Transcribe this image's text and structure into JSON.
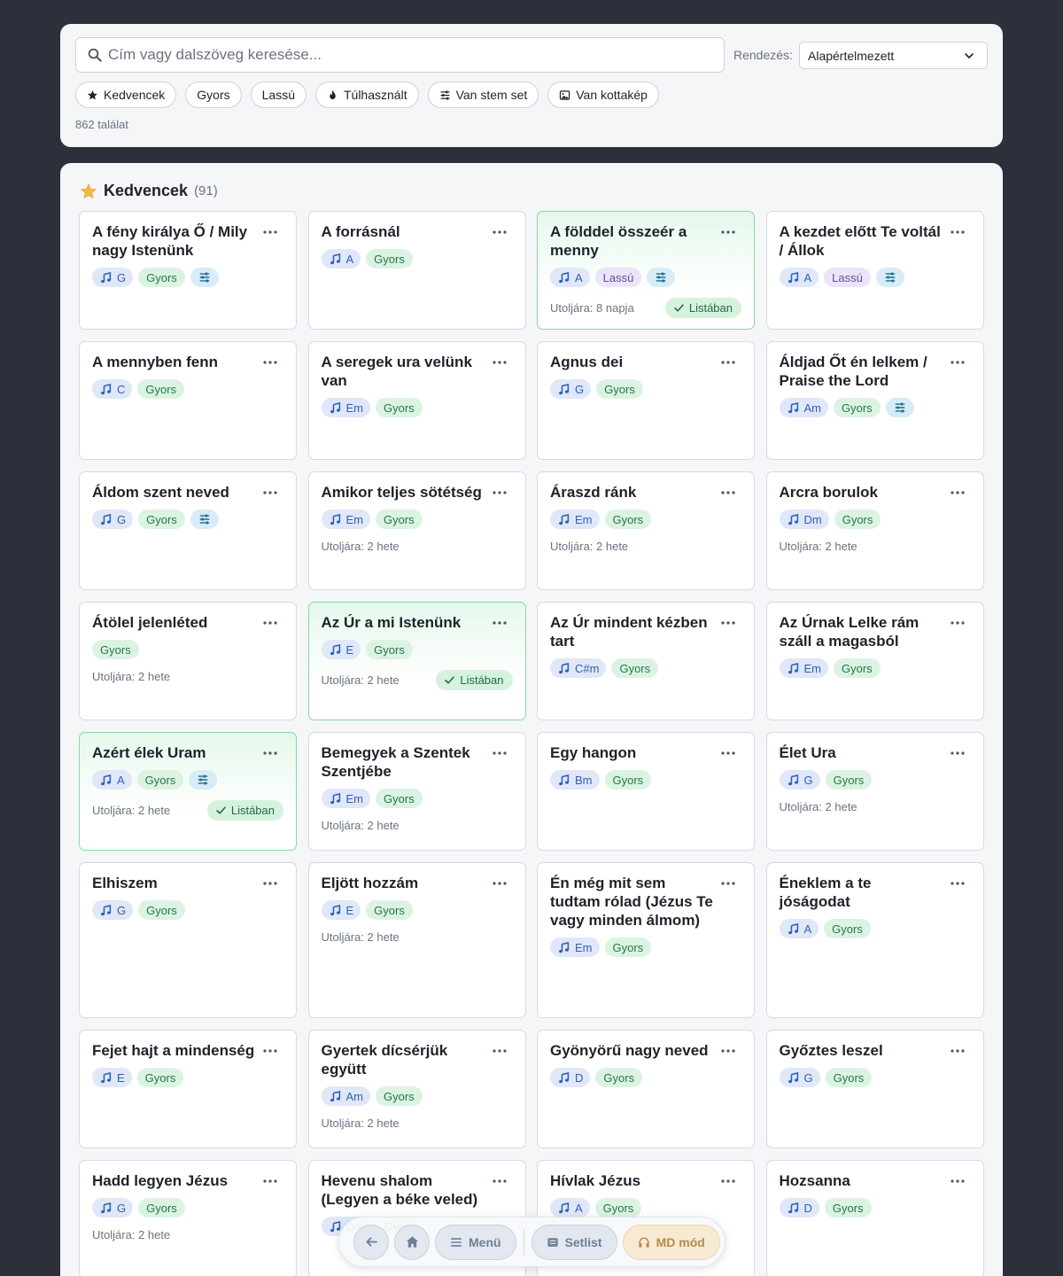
{
  "search": {
    "placeholder": "Cím vagy dalszöveg keresése..."
  },
  "sort": {
    "label": "Rendezés:",
    "value": "Alapértelmezett"
  },
  "filters": [
    {
      "label": "Kedvencek",
      "icon": "star-icon"
    },
    {
      "label": "Gyors"
    },
    {
      "label": "Lassú"
    },
    {
      "label": "Túlhasznált",
      "icon": "fire-icon"
    },
    {
      "label": "Van stem set",
      "icon": "sliders-icon"
    },
    {
      "label": "Van kottakép",
      "icon": "image-icon"
    }
  ],
  "result_count": "862 találat",
  "section": {
    "title": "Kedvencek",
    "count": "(91)"
  },
  "listed_label": "Listában",
  "songs": [
    {
      "title": "A fény királya Ő / Mily nagy Istenünk",
      "key": "G",
      "tempo": "Gyors",
      "stem": true
    },
    {
      "title": "A forrásnál",
      "key": "A",
      "tempo": "Gyors"
    },
    {
      "title": "A földdel összeér a menny",
      "key": "A",
      "tempo": "Lassú",
      "stem": true,
      "last_used": "Utoljára: 8 napja",
      "listed": true
    },
    {
      "title": "A kezdet előtt Te voltál / Állok",
      "key": "A",
      "tempo": "Lassú",
      "stem": true
    },
    {
      "title": "A mennyben fenn",
      "key": "C",
      "tempo": "Gyors"
    },
    {
      "title": "A seregek ura velünk van",
      "key": "Em",
      "tempo": "Gyors"
    },
    {
      "title": "Agnus dei",
      "key": "G",
      "tempo": "Gyors"
    },
    {
      "title": "Áldjad Őt én lelkem / Praise the Lord",
      "key": "Am",
      "tempo": "Gyors",
      "stem": true
    },
    {
      "title": "Áldom szent neved",
      "key": "G",
      "tempo": "Gyors",
      "stem": true
    },
    {
      "title": "Amikor teljes sötétség",
      "key": "Em",
      "tempo": "Gyors",
      "last_used": "Utoljára: 2 hete"
    },
    {
      "title": "Áraszd ránk",
      "key": "Em",
      "tempo": "Gyors",
      "last_used": "Utoljára: 2 hete"
    },
    {
      "title": "Arcra borulok",
      "key": "Dm",
      "tempo": "Gyors",
      "last_used": "Utoljára: 2 hete"
    },
    {
      "title": "Átölel jelenléted",
      "tempo": "Gyors",
      "last_used": "Utoljára: 2 hete"
    },
    {
      "title": "Az Úr a mi Istenünk",
      "key": "E",
      "tempo": "Gyors",
      "last_used": "Utoljára: 2 hete",
      "listed": true
    },
    {
      "title": "Az Úr mindent kézben tart",
      "key": "C#m",
      "tempo": "Gyors"
    },
    {
      "title": "Az Úrnak Lelke rám száll a magasból",
      "key": "Em",
      "tempo": "Gyors"
    },
    {
      "title": "Azért élek Uram",
      "key": "A",
      "tempo": "Gyors",
      "stem": true,
      "last_used": "Utoljára: 2 hete",
      "listed": true
    },
    {
      "title": "Bemegyek a Szentek Szentjébe",
      "key": "Em",
      "tempo": "Gyors",
      "last_used": "Utoljára: 2 hete"
    },
    {
      "title": "Egy hangon",
      "key": "Bm",
      "tempo": "Gyors"
    },
    {
      "title": "Élet Ura",
      "key": "G",
      "tempo": "Gyors",
      "last_used": "Utoljára: 2 hete"
    },
    {
      "title": "Elhiszem",
      "key": "G",
      "tempo": "Gyors"
    },
    {
      "title": "Eljött hozzám",
      "key": "E",
      "tempo": "Gyors",
      "last_used": "Utoljára: 2 hete"
    },
    {
      "title": "Én még mit sem tudtam rólad (Jézus Te vagy minden álmom)",
      "key": "Em",
      "tempo": "Gyors"
    },
    {
      "title": "Éneklem a te jóságodat",
      "key": "A",
      "tempo": "Gyors"
    },
    {
      "title": "Fejet hajt a mindenség",
      "key": "E",
      "tempo": "Gyors"
    },
    {
      "title": "Gyertek dícsérjük együtt",
      "key": "Am",
      "tempo": "Gyors",
      "last_used": "Utoljára: 2 hete"
    },
    {
      "title": "Gyönyörű nagy neved",
      "key": "D",
      "tempo": "Gyors"
    },
    {
      "title": "Győztes leszel",
      "key": "G",
      "tempo": "Gyors"
    },
    {
      "title": "Hadd legyen Jézus",
      "key": "G",
      "tempo": "Gyors",
      "last_used": "Utoljára: 2 hete"
    },
    {
      "title": "Hevenu shalom (Legyen a béke veled)",
      "key": "Dm",
      "tempo": "Gyors"
    },
    {
      "title": "Hívlak Jézus",
      "key": "A",
      "tempo": "Gyors"
    },
    {
      "title": "Hozsanna",
      "key": "D",
      "tempo": "Gyors"
    }
  ],
  "bottom_bar": {
    "back_icon": "arrow-left-icon",
    "home_icon": "home-icon",
    "menu_label": "Menü",
    "setlist_label": "Setlist",
    "md_label": "MD mód"
  },
  "colors": {
    "accent_green": "#86d9a4",
    "key_blue": "#2f5fb4",
    "star": "#f2b941",
    "background": "#2b303b"
  }
}
